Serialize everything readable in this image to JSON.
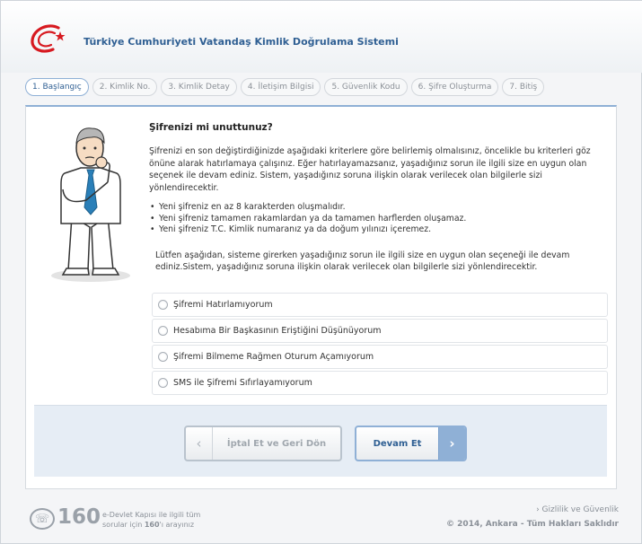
{
  "header": {
    "title": "Türkiye Cumhuriyeti Vatandaş Kimlik Doğrulama Sistemi"
  },
  "steps": [
    {
      "label": "1. Başlangıç",
      "active": true
    },
    {
      "label": "2. Kimlik No.",
      "active": false
    },
    {
      "label": "3. Kimlik Detay",
      "active": false
    },
    {
      "label": "4. İletişim Bilgisi",
      "active": false
    },
    {
      "label": "5. Güvenlik Kodu",
      "active": false
    },
    {
      "label": "6. Şifre Oluşturma",
      "active": false
    },
    {
      "label": "7. Bitiş",
      "active": false
    }
  ],
  "main": {
    "question": "Şifrenizi mi unuttunuz?",
    "intro": "Şifrenizi en son değiştirdiğinizde aşağıdaki kriterlere göre belirlemiş olmalısınız, öncelikle bu kriterleri göz önüne alarak hatırlamaya çalışınız. Eğer hatırlayamazsanız, yaşadığınız sorun ile ilgili size en uygun olan seçenek ile devam ediniz. Sistem, yaşadığınız soruna ilişkin olarak verilecek olan bilgilerle sizi yönlendirecektir.",
    "rules": [
      "Yeni şifreniz en az 8 karakterden oluşmalıdır.",
      "Yeni şifreniz tamamen rakamlardan ya da tamamen harflerden oluşamaz.",
      "Yeni şifreniz T.C. Kimlik numaranız ya da doğum yılınızı içeremez."
    ],
    "instruction": "Lütfen aşağıdan, sisteme girerken yaşadığınız sorun ile ilgili size en uygun olan seçeneği ile devam ediniz.Sistem, yaşadığınız soruna ilişkin olarak verilecek olan bilgilerle sizi yönlendirecektir.",
    "options": [
      "Şifremi Hatırlamıyorum",
      "Hesabıma Bir Başkasının Eriştiğini Düşünüyorum",
      "Şifremi Bilmeme Rağmen Oturum Açamıyorum",
      "SMS ile Şifremi Sıfırlayamıyorum"
    ]
  },
  "buttons": {
    "cancel_label": "İptal Et ve Geri Dön",
    "next_label": "Devam Et"
  },
  "footer": {
    "number": "160",
    "support_line1": "e-Devlet Kapısı ile ilgili tüm",
    "support_line2_prefix": "sorular için ",
    "support_line2_number": "160",
    "support_line2_suffix": "'ı arayınız",
    "privacy": "Gizlilik ve Güvenlik",
    "copyright": "© 2014, Ankara - Tüm Hakları Saklıdır"
  },
  "colors": {
    "brand_blue": "#2f5f93",
    "accent_red": "#d71920",
    "panel_accent": "#8fb0d6"
  }
}
